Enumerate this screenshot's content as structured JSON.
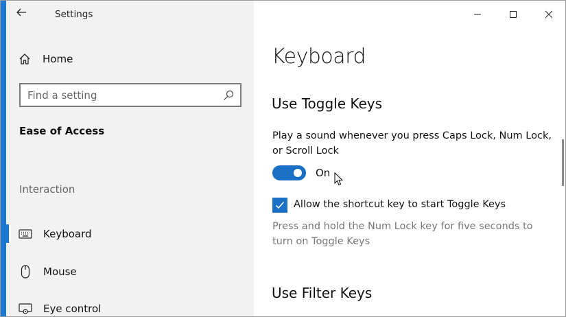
{
  "window": {
    "title": "Settings",
    "controls": [
      "minimize",
      "maximize",
      "close"
    ]
  },
  "sidebar": {
    "home_label": "Home",
    "search": {
      "placeholder": "Find a setting",
      "value": ""
    },
    "section_title": "Ease of Access",
    "group_label": "Interaction",
    "items": [
      {
        "label": "Keyboard",
        "icon": "keyboard-icon",
        "selected": true
      },
      {
        "label": "Mouse",
        "icon": "mouse-icon",
        "selected": false
      },
      {
        "label": "Eye control",
        "icon": "eye-control-icon",
        "selected": false
      }
    ]
  },
  "main": {
    "page_title": "Keyboard",
    "toggle_keys": {
      "heading": "Use Toggle Keys",
      "description": "Play a sound whenever you press Caps Lock, Num Lock, or Scroll Lock",
      "toggle_state": "On",
      "shortcut_checkbox_label": "Allow the shortcut key to start Toggle Keys",
      "shortcut_checked": true,
      "shortcut_hint": "Press and hold the Num Lock key for five seconds to turn on Toggle Keys"
    },
    "filter_keys": {
      "heading": "Use Filter Keys"
    }
  },
  "colors": {
    "accent": "#1b6fc4",
    "sidebar_bg": "#f2f2f2",
    "hint_text": "#777777"
  }
}
